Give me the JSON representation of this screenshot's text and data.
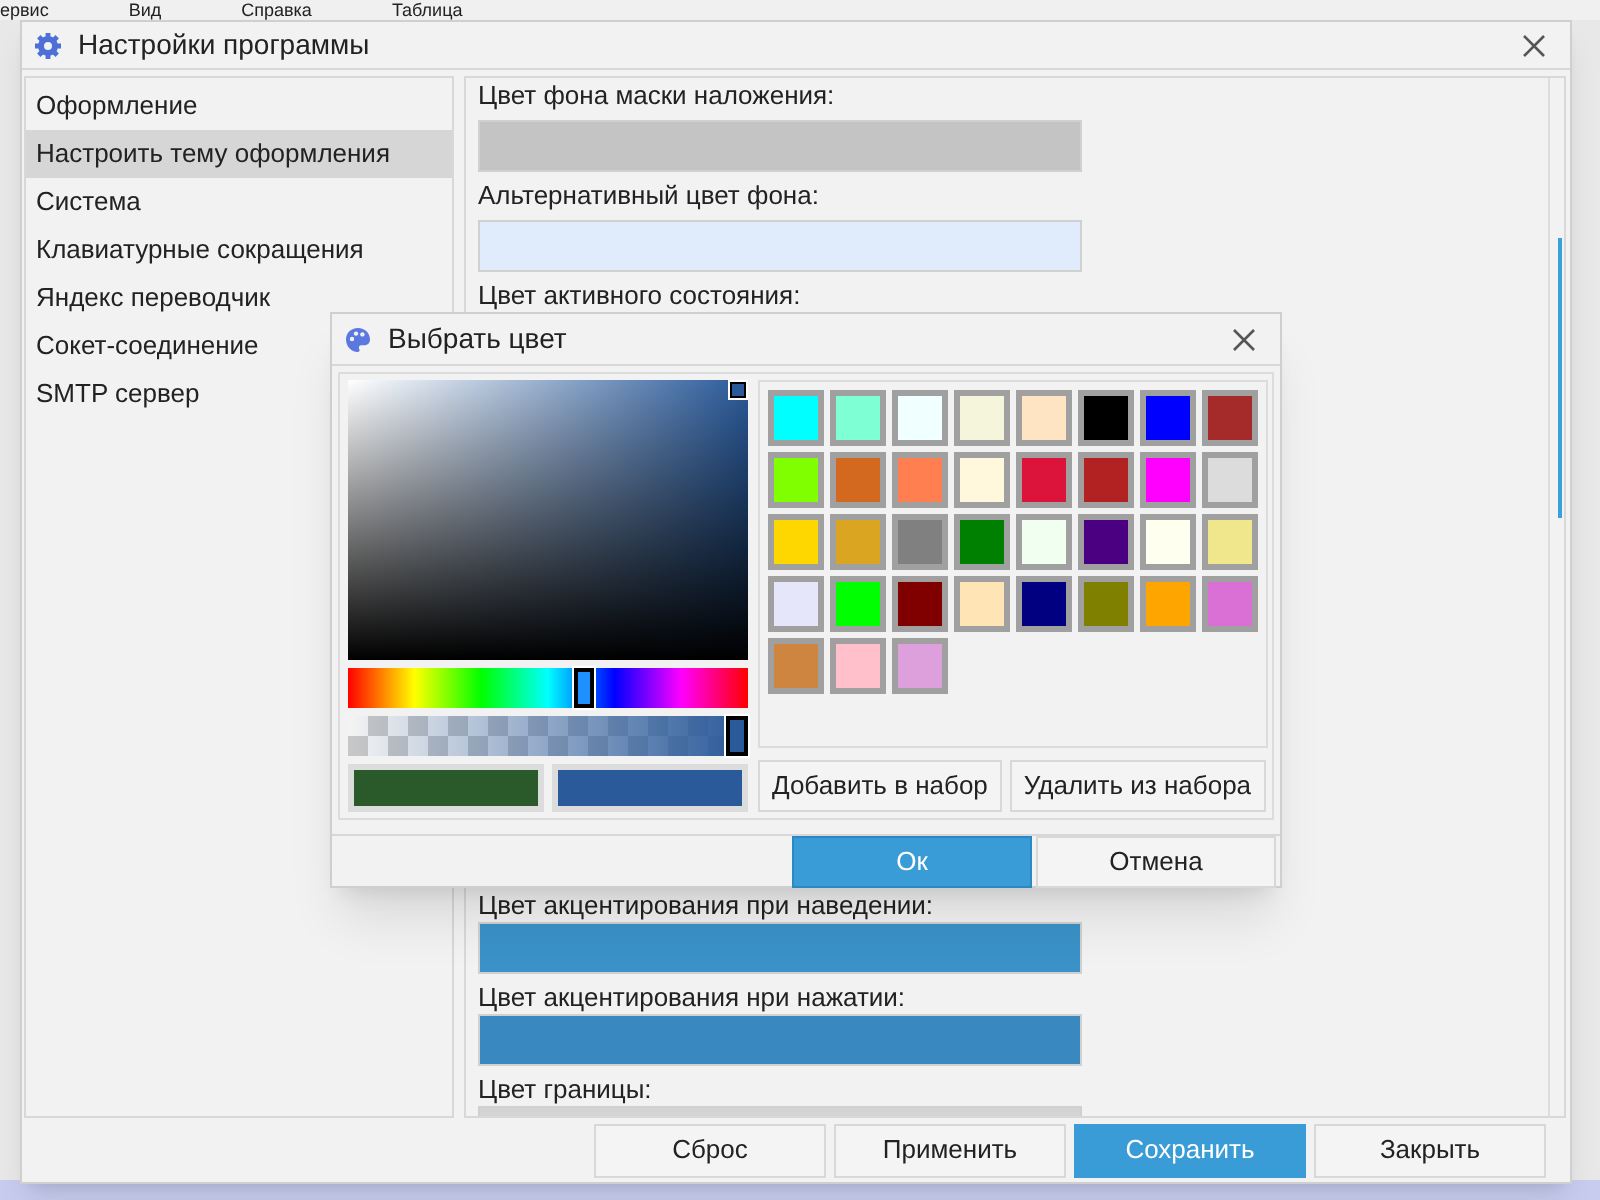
{
  "background_app": {
    "menu": [
      {
        "label": "ервис"
      },
      {
        "label": "Вид"
      },
      {
        "label": "Справка"
      },
      {
        "label": "Таблица"
      }
    ]
  },
  "settings_window": {
    "title": "Настройки программы",
    "nav": [
      {
        "label": "Оформление",
        "selected": false
      },
      {
        "label": "Настроить тему оформления",
        "selected": true
      },
      {
        "label": "Система",
        "selected": false
      },
      {
        "label": "Клавиатурные сокращения",
        "selected": false
      },
      {
        "label": "Яндекс переводчик",
        "selected": false
      },
      {
        "label": "Сокет-соединение",
        "selected": false
      },
      {
        "label": "SMTP сервер",
        "selected": false
      }
    ],
    "fields": [
      {
        "label": "Цвет фона маски наложения:",
        "color": "#c4c4c4"
      },
      {
        "label": "Альтернативный цвет фона:",
        "color": "#e0ecfc"
      },
      {
        "label": "Цвет активного состояния:"
      },
      {
        "label": "Цвет акцентирования при наведении:",
        "color": "#3a92c8"
      },
      {
        "label": "Цвет акцентирования нри нажатии:",
        "color": "#3a88c0"
      },
      {
        "label": "Цвет границы:",
        "color": "#d4d4d4"
      }
    ],
    "buttons": [
      {
        "label": "Сброс",
        "primary": false
      },
      {
        "label": "Применить",
        "primary": false
      },
      {
        "label": "Сохранить",
        "primary": true
      },
      {
        "label": "Закрыть",
        "primary": false
      }
    ]
  },
  "color_dialog": {
    "title": "Выбрать цвет",
    "preview": [
      {
        "color": "#2a5a2a"
      },
      {
        "color": "#2a5a9a"
      }
    ],
    "hue_slider": {
      "level": 0.59
    },
    "alpha_slider": {
      "level": 1
    },
    "swatches": [
      {
        "color": "#00ffff"
      },
      {
        "color": "#7fffd4"
      },
      {
        "color": "#f0ffff"
      },
      {
        "color": "#f5f5dc"
      },
      {
        "color": "#ffe4c4"
      },
      {
        "color": "#000000"
      },
      {
        "color": "#0000ff"
      },
      {
        "color": "#a52a2a"
      },
      {
        "color": "#7fff00"
      },
      {
        "color": "#d2691e"
      },
      {
        "color": "#ff7f50"
      },
      {
        "color": "#fff8dc"
      },
      {
        "color": "#dc143c"
      },
      {
        "color": "#b22222"
      },
      {
        "color": "#ff00ff"
      },
      {
        "color": "#dcdcdc"
      },
      {
        "color": "#ffd700"
      },
      {
        "color": "#daa520"
      },
      {
        "color": "#808080"
      },
      {
        "color": "#008000"
      },
      {
        "color": "#f0fff0"
      },
      {
        "color": "#4b0082"
      },
      {
        "color": "#fffff0"
      },
      {
        "color": "#f0e68c"
      },
      {
        "color": "#e6e6fa"
      },
      {
        "color": "#00ff00"
      },
      {
        "color": "#800000"
      },
      {
        "color": "#ffe4b5"
      },
      {
        "color": "#000080"
      },
      {
        "color": "#808000"
      },
      {
        "color": "#ffa500"
      },
      {
        "color": "#da70d6"
      },
      {
        "color": "#cd853f"
      },
      {
        "color": "#ffc0cb"
      },
      {
        "color": "#dda0dd"
      }
    ],
    "palette_buttons": [
      "Добавить в набор",
      "Удалить из набора"
    ],
    "buttons": [
      {
        "label": "Ок",
        "primary": true
      },
      {
        "label": "Отмена",
        "primary": false
      }
    ]
  }
}
